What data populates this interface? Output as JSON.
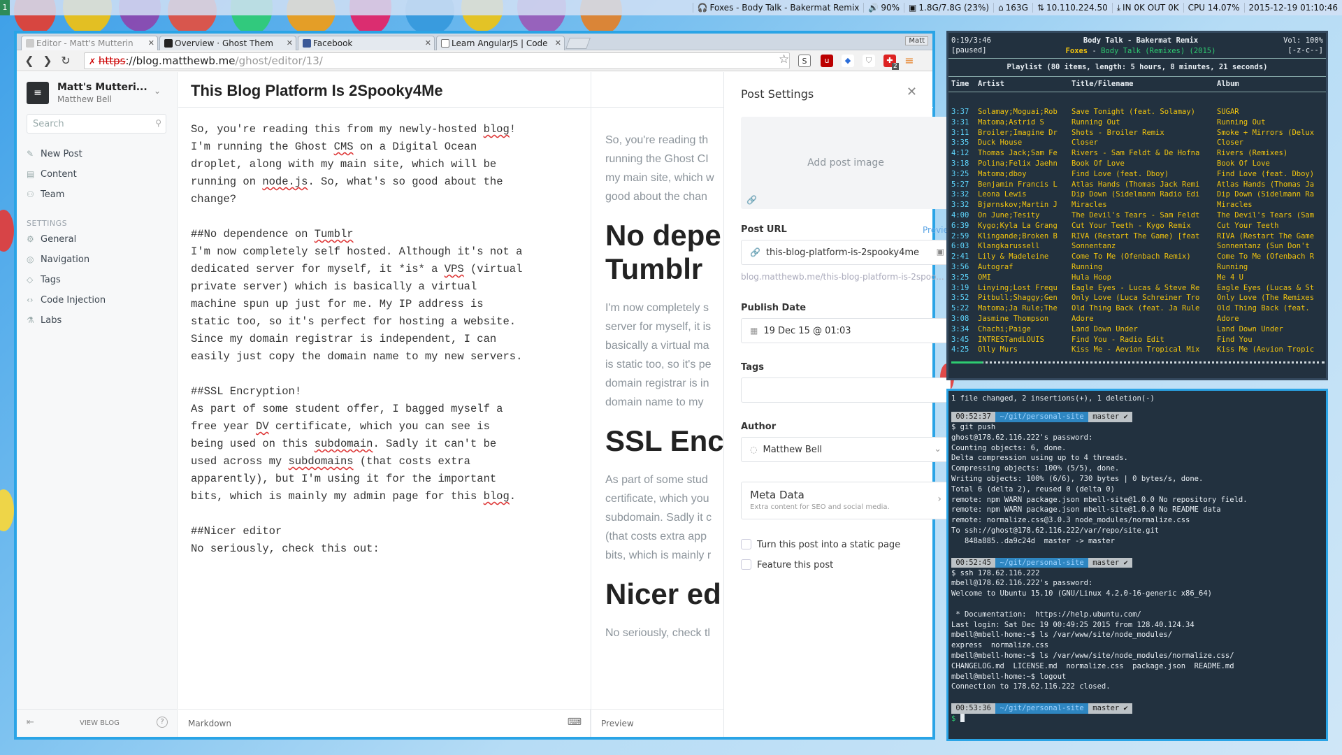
{
  "topbar": {
    "workspace": "1",
    "now_playing": "Foxes - Body Talk - Bakermat Remix",
    "volume": "90%",
    "memory": "1.8G/7.8G (23%)",
    "disk": "163G",
    "ip": "10.110.224.50",
    "net": "IN 0K OUT 0K",
    "cpu": "CPU 14.07%",
    "datetime": "2015-12-19 01:10:46"
  },
  "browser": {
    "tabs": [
      {
        "title": "Editor - Matt's Mutterin"
      },
      {
        "title": "Overview · Ghost Them"
      },
      {
        "title": "Facebook"
      },
      {
        "title": "Learn AngularJS | Code"
      }
    ],
    "user_button": "Matt",
    "url_scheme": "https",
    "url_host": "://blog.matthewb.me",
    "url_path": "/ghost/editor/13/",
    "extension_badge": "2"
  },
  "ghost": {
    "blog_title": "Matt's Mutteri...",
    "blog_author": "Matthew Bell",
    "search_placeholder": "Search",
    "nav": [
      "New Post",
      "Content",
      "Team"
    ],
    "settings_header": "SETTINGS",
    "settings_nav": [
      "General",
      "Navigation",
      "Tags",
      "Code Injection",
      "Labs"
    ],
    "view_blog": "VIEW BLOG",
    "help": "?",
    "post_title": "This Blog Platform Is 2Spooky4Me",
    "markdown_label": "Markdown",
    "preview_label": "Preview",
    "markdown_lines": [
      [
        "So, you're reading this from my newly-hosted ",
        {
          "sp": "blog"
        },
        "!"
      ],
      [
        "I'm running the Ghost ",
        {
          "sp": "CMS"
        },
        " on a Digital Ocean"
      ],
      [
        "droplet, along with my main site, which will be"
      ],
      [
        "running on ",
        {
          "sp": "node.js"
        },
        ". So, what's so good about the"
      ],
      [
        "change?"
      ],
      [
        ""
      ],
      [
        "##No dependence on ",
        {
          "sp": "Tumblr"
        }
      ],
      [
        "I'm now completely self hosted. Although it's not a"
      ],
      [
        "dedicated server for myself, it *is* a ",
        {
          "sp": "VPS"
        },
        " (virtual"
      ],
      [
        "private server) which is basically a virtual"
      ],
      [
        "machine spun up just for me. My IP address is"
      ],
      [
        "static too, so it's perfect for hosting a website."
      ],
      [
        "Since my domain registrar is independent, I can"
      ],
      [
        "easily just copy the domain name to my new servers."
      ],
      [
        ""
      ],
      [
        "##SSL Encryption!"
      ],
      [
        "As part of some student offer, I bagged myself a"
      ],
      [
        "free year ",
        {
          "sp": "DV"
        },
        " certificate, which you can see is"
      ],
      [
        "being used on this ",
        {
          "sp": "subdomain"
        },
        ". Sadly it can't be"
      ],
      [
        "used across my ",
        {
          "sp": "subdomains"
        },
        " (that costs extra"
      ],
      [
        "apparently), but I'm using it for the important"
      ],
      [
        "bits, which is mainly my admin page for this ",
        {
          "sp": "blog"
        },
        "."
      ],
      [
        ""
      ],
      [
        "##Nicer editor"
      ],
      [
        "No seriously, check this out:"
      ]
    ],
    "preview_blocks": [
      {
        "type": "p",
        "text": "So, you're reading th\nrunning the Ghost CI\nmy main site, which w\ngood about the chan"
      },
      {
        "type": "h",
        "text": "No depe\nTumblr"
      },
      {
        "type": "p",
        "text": "I'm now completely s\nserver for myself, it is\nbasically a virtual ma\nis static too, so it's pe\ndomain registrar is in\ndomain name to my"
      },
      {
        "type": "h",
        "text": "SSL Encr"
      },
      {
        "type": "p",
        "text": "As part of some stud\ncertificate, which you\nsubdomain. Sadly it c\n(that costs extra app\nbits, which is mainly r"
      },
      {
        "type": "h",
        "text": "Nicer ed"
      },
      {
        "type": "p",
        "text": "No seriously, check tl"
      }
    ],
    "post_settings": {
      "header": "Post Settings",
      "add_image": "Add post image",
      "url_label": "Post URL",
      "url_preview": "Preview",
      "url_value": "this-blog-platform-is-2spooky4me",
      "url_full": "blog.matthewb.me/this-blog-platform-is-2spoo...",
      "date_label": "Publish Date",
      "date_value": "19 Dec 15 @ 01:03",
      "tags_label": "Tags",
      "author_label": "Author",
      "author_value": "Matthew Bell",
      "meta_title": "Meta Data",
      "meta_sub": "Extra content for SEO and social media.",
      "static_page": "Turn this post into a static page",
      "feature": "Feature this post"
    }
  },
  "music": {
    "time": "0:19/3:46",
    "status": "[paused]",
    "track": "Body Talk - Bakermat Remix",
    "artist": "Foxes",
    "album_info": "Body Talk (Remixes) (2015)",
    "volume": "Vol: 100%",
    "flags": "[-z-c--]",
    "playlist_info": "Playlist (80 items, length: 5 hours, 8 minutes, 21 seconds)",
    "headers": [
      "Time",
      "Artist",
      "Title/Filename",
      "Album"
    ],
    "rows": [
      [
        "3:37",
        "Solamay;Moguai;Rob",
        "Save Tonight (feat. Solamay)",
        "SUGAR"
      ],
      [
        "3:31",
        "Matoma;Astrid S",
        "Running Out",
        "Running Out"
      ],
      [
        "3:11",
        "Broiler;Imagine Dr",
        "Shots - Broiler Remix",
        "Smoke + Mirrors (Delux"
      ],
      [
        "3:35",
        "Duck House",
        "Closer",
        "Closer"
      ],
      [
        "4:12",
        "Thomas Jack;Sam Fe",
        "Rivers - Sam Feldt & De Hofna",
        "Rivers (Remixes)"
      ],
      [
        "3:18",
        "Polina;Felix Jaehn",
        "Book Of Love",
        "Book Of Love"
      ],
      [
        "3:25",
        "Matoma;dboy",
        "Find Love (feat. Dboy)",
        "Find Love (feat. Dboy)"
      ],
      [
        "5:27",
        "Benjamin Francis L",
        "Atlas Hands (Thomas Jack Remi",
        "Atlas Hands (Thomas Ja"
      ],
      [
        "3:32",
        "Leona Lewis",
        "Dip Down (Sidelmann Radio Edi",
        "Dip Down (Sidelmann Ra"
      ],
      [
        "3:32",
        "Bjørnskov;Martin J",
        "Miracles",
        "Miracles"
      ],
      [
        "4:00",
        "On June;Tesity",
        "The Devil's Tears - Sam Feldt",
        "The Devil's Tears (Sam"
      ],
      [
        "6:39",
        "Kygo;Kyla La Grang",
        "Cut Your Teeth - Kygo Remix",
        "Cut Your Teeth"
      ],
      [
        "2:59",
        "Klingande;Broken B",
        "RIVA (Restart The Game) [feat",
        "RIVA (Restart The Game"
      ],
      [
        "6:03",
        "Klangkarussell",
        "Sonnentanz",
        "Sonnentanz (Sun Don't"
      ],
      [
        "2:41",
        "Lily & Madeleine",
        "Come To Me (Ofenbach Remix)",
        "Come To Me (Ofenbach R"
      ],
      [
        "3:56",
        "Autograf",
        "Running",
        "Running"
      ],
      [
        "3:25",
        "OMI",
        "Hula Hoop",
        "Me 4 U"
      ],
      [
        "3:19",
        "Linying;Lost Frequ",
        "Eagle Eyes - Lucas & Steve Re",
        "Eagle Eyes (Lucas & St"
      ],
      [
        "3:52",
        "Pitbull;Shaggy;Gen",
        "Only Love (Luca Schreiner Tro",
        "Only Love (The Remixes"
      ],
      [
        "5:22",
        "Matoma;Ja Rule;The",
        "Old Thing Back (feat. Ja Rule",
        "Old Thing Back (feat."
      ],
      [
        "3:08",
        "Jasmine Thompson",
        "Adore",
        "Adore"
      ],
      [
        "3:34",
        "Chachi;Paige",
        "Land Down Under",
        "Land Down Under"
      ],
      [
        "3:45",
        "INTRESTandLOUIS",
        "Find You - Radio Edit",
        "Find You"
      ],
      [
        "4:25",
        "Olly Murs",
        "Kiss Me - Aevion Tropical Mix",
        "Kiss Me (Aevion Tropic"
      ]
    ],
    "progress": 0.085
  },
  "terminal": {
    "header_line": "1 file changed, 2 insertions(+), 1 deletion(-)",
    "blocks": [
      {
        "time": "00:52:37",
        "dir": "~/git/personal-site",
        "branch": "master ✔",
        "cmd": "git push",
        "output": "ghost@178.62.116.222's password:\nCounting objects: 6, done.\nDelta compression using up to 4 threads.\nCompressing objects: 100% (5/5), done.\nWriting objects: 100% (6/6), 730 bytes | 0 bytes/s, done.\nTotal 6 (delta 2), reused 0 (delta 0)\nremote: npm WARN package.json mbell-site@1.0.0 No repository field.\nremote: npm WARN package.json mbell-site@1.0.0 No README data\nremote: normalize.css@3.0.3 node_modules/normalize.css\nTo ssh://ghost@178.62.116.222/var/repo/site.git\n   848a885..da9c24d  master -> master"
      },
      {
        "time": "00:52:45",
        "dir": "~/git/personal-site",
        "branch": "master ✔",
        "cmd": "ssh 178.62.116.222",
        "output": "mbell@178.62.116.222's password:\nWelcome to Ubuntu 15.10 (GNU/Linux 4.2.0-16-generic x86_64)\n\n * Documentation:  https://help.ubuntu.com/\nLast login: Sat Dec 19 00:49:25 2015 from 128.40.124.34\nmbell@mbell-home:~$ ls /var/www/site/node_modules/\nexpress  normalize.css\nmbell@mbell-home:~$ ls /var/www/site/node_modules/normalize.css/\nCHANGELOG.md  LICENSE.md  normalize.css  package.json  README.md\nmbell@mbell-home:~$ logout\nConnection to 178.62.116.222 closed."
      },
      {
        "time": "00:53:36",
        "dir": "~/git/personal-site",
        "branch": "master ✔",
        "cmd": "",
        "output": ""
      }
    ],
    "prompt": "$"
  },
  "colors": {
    "accent": "#2aa4e6",
    "terminal_bg": "#22313f",
    "music_yellow": "#f1c40f",
    "music_cyan": "#5fd7ff",
    "prompt_time_bg": "#bdc3c7",
    "prompt_dir_bg": "#2e86c1"
  }
}
